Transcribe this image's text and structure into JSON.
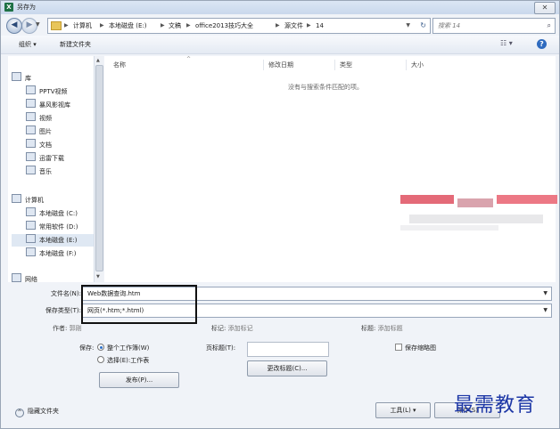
{
  "window": {
    "title": "另存为",
    "app_icon": "excel-icon"
  },
  "address": {
    "crumbs": [
      "计算机",
      "本地磁盘 (E:)",
      "文稿",
      "office2013技巧大全",
      "源文件",
      "14"
    ],
    "search_placeholder": "搜索 14"
  },
  "toolbar": {
    "organize": "组织 ▾",
    "new_folder": "新建文件夹"
  },
  "nav": {
    "libraries": "库",
    "library_items": [
      "PPTV视频",
      "暴风影视库",
      "视频",
      "图片",
      "文档",
      "迅雷下载",
      "音乐"
    ],
    "computer": "计算机",
    "drives": [
      "本地磁盘 (C:)",
      "常用软件 (D:)",
      "本地磁盘 (E:)",
      "本地磁盘 (F:)"
    ],
    "network": "网络",
    "selected": "本地磁盘 (E:)"
  },
  "list": {
    "columns": [
      "名称",
      "修改日期",
      "类型",
      "大小"
    ],
    "empty_message": "没有与搜索条件匹配的项。"
  },
  "form": {
    "filename_label": "文件名(N):",
    "filename_value": "Web数据查询.htm",
    "savetype_label": "保存类型(T):",
    "savetype_value": "网页(*.htm;*.html)",
    "author_label": "作者:",
    "author_value": "郭刚",
    "tags_label": "标记:",
    "tags_value": "添加标记",
    "title_label": "标题:",
    "title_value": "添加标题",
    "save_label": "保存:",
    "option_workbook": "整个工作簿(W)",
    "option_selection": "选择(E):工作表",
    "publish_button": "发布(P)...",
    "page_title_label": "页标题(T):",
    "change_title_button": "更改标题(C)...",
    "save_thumbnail": "保存缩略图"
  },
  "footer": {
    "hide_folders": "隐藏文件夹",
    "tools_button": "工具(L)",
    "save_button": "保存(S)"
  },
  "watermark": "最需教育"
}
